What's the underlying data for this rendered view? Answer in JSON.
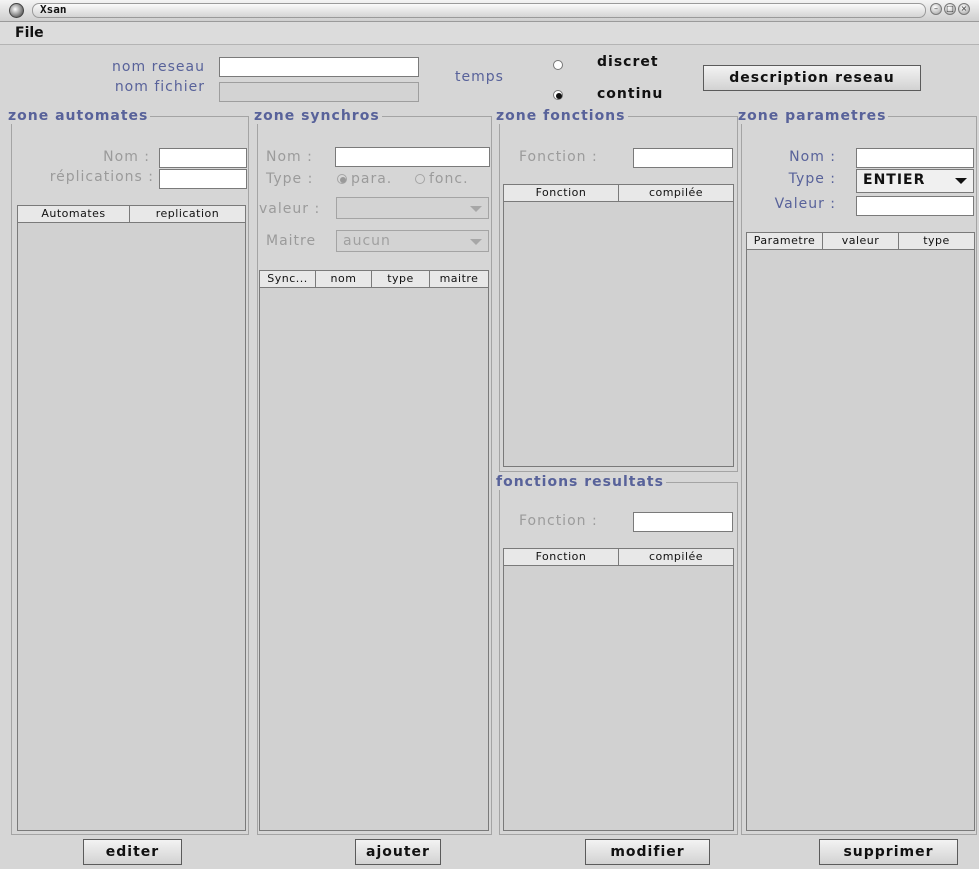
{
  "window": {
    "title": "Xsan"
  },
  "menubar": {
    "file_label": "File"
  },
  "top": {
    "nom_reseau_label": "nom reseau",
    "nom_reseau_value": "",
    "nom_fichier_label": "nom fichier",
    "nom_fichier_value": "",
    "temps_label": "temps",
    "discret_label": "discret",
    "continu_label": "continu",
    "selected_temps": "continu",
    "description_button": "description reseau"
  },
  "zone_automates": {
    "title": "zone automates",
    "nom_label": "Nom :",
    "replications_label": "réplications :",
    "columns": [
      "Automates",
      "replication"
    ]
  },
  "zone_synchros": {
    "title": "zone synchros",
    "nom_label": "Nom :",
    "type_label": "Type :",
    "para_label": "para.",
    "fonc_label": "fonc.",
    "valeur_label": "valeur :",
    "maitre_label": "Maitre",
    "maitre_value": "aucun",
    "columns": [
      "Sync...",
      "nom",
      "type",
      "maitre"
    ]
  },
  "zone_fonctions": {
    "title": "zone fonctions",
    "fonction_label": "Fonction :",
    "columns": [
      "Fonction",
      "compilée"
    ]
  },
  "fonctions_resultats": {
    "title": "fonctions resultats",
    "fonction_label": "Fonction :",
    "columns": [
      "Fonction",
      "compilée"
    ]
  },
  "zone_parametres": {
    "title": "zone parametres",
    "nom_label": "Nom :",
    "type_label": "Type :",
    "type_value": "ENTIER",
    "valeur_label": "Valeur :",
    "columns": [
      "Parametre",
      "valeur",
      "type"
    ]
  },
  "buttons": {
    "editer": "editer",
    "ajouter": "ajouter",
    "modifier": "modifier",
    "supprimer": "supprimer"
  },
  "colors": {
    "label_blue": "#58629a",
    "background": "#d6d6d6"
  }
}
